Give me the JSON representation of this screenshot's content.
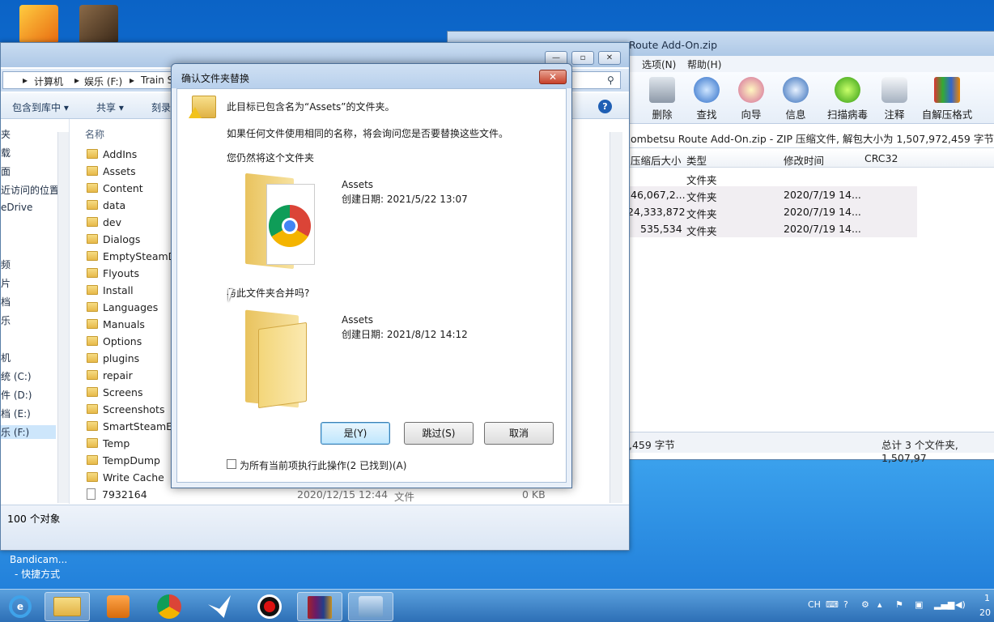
{
  "explorer": {
    "breadcrumb": [
      "计算机",
      "娱乐 (F:)",
      "Train S"
    ],
    "toolbar": {
      "include_library": "包含到库中",
      "share": "共享",
      "burn": "刻录"
    },
    "nav_items": [
      "夹",
      "载",
      "面",
      "近访问的位置",
      "eDrive",
      "",
      "",
      "频",
      "片",
      "档",
      "乐",
      "",
      "机",
      "统 (C:)",
      "件 (D:)",
      "档 (E:)",
      "乐 (F:)"
    ],
    "col_name": "名称",
    "files": [
      {
        "name": "AddIns",
        "type": "folder"
      },
      {
        "name": "Assets",
        "type": "folder"
      },
      {
        "name": "Content",
        "type": "folder"
      },
      {
        "name": "data",
        "type": "folder"
      },
      {
        "name": "dev",
        "type": "folder"
      },
      {
        "name": "Dialogs",
        "type": "folder"
      },
      {
        "name": "EmptySteamDe",
        "type": "folder"
      },
      {
        "name": "Flyouts",
        "type": "folder"
      },
      {
        "name": "Install",
        "type": "folder"
      },
      {
        "name": "Languages",
        "type": "folder"
      },
      {
        "name": "Manuals",
        "type": "folder"
      },
      {
        "name": "Options",
        "type": "folder"
      },
      {
        "name": "plugins",
        "type": "folder"
      },
      {
        "name": "repair",
        "type": "folder"
      },
      {
        "name": "Screens",
        "type": "folder"
      },
      {
        "name": "Screenshots",
        "type": "folder"
      },
      {
        "name": "SmartSteamEm",
        "type": "folder"
      },
      {
        "name": "Temp",
        "type": "folder"
      },
      {
        "name": "TempDump",
        "type": "folder"
      },
      {
        "name": "Write Cache",
        "type": "folder"
      },
      {
        "name": "7932164",
        "type": "file",
        "date": "2020/12/15 12:44",
        "kind": "文件",
        "size": "0 KB"
      }
    ],
    "status": "100 个对象"
  },
  "rar": {
    "title": "Route Add-On.zip",
    "menu": {
      "options": "选项(N)",
      "help": "帮助(H)"
    },
    "buttons": [
      "删除",
      "查找",
      "向导",
      "信息",
      "扫描病毒",
      "注释",
      "自解压格式"
    ],
    "info": "ombetsu Route Add-On.zip - ZIP 压缩文件, 解包大小为 1,507,972,459 字节",
    "headers": {
      "packed": "压缩后大小",
      "type": "类型",
      "modified": "修改时间",
      "crc": "CRC32"
    },
    "rows": [
      {
        "packed": "",
        "type": "文件夹",
        "modified": ""
      },
      {
        "packed": "46,067,2...",
        "type": "文件夹",
        "modified": "2020/7/19 14..."
      },
      {
        "packed": "24,333,872",
        "type": "文件夹",
        "modified": "2020/7/19 14..."
      },
      {
        "packed": "535,534",
        "type": "文件夹",
        "modified": "2020/7/19 14..."
      }
    ],
    "status_left": ",459 字节",
    "status_right": "总计 3 个文件夹, 1,507,97"
  },
  "dialog": {
    "title": "确认文件夹替换",
    "line1": "此目标已包含名为“Assets”的文件夹。",
    "line2": "如果任何文件使用相同的名称，将会询问您是否要替换这些文件。",
    "line3": "您仍然将这个文件夹",
    "src": {
      "name": "Assets",
      "date": "创建日期: 2021/5/22 13:07"
    },
    "merge_q": "与此文件夹合并吗?",
    "dst": {
      "name": "Assets",
      "date": "创建日期: 2021/8/12 14:12"
    },
    "btn_yes": "是(Y)",
    "btn_skip": "跳过(S)",
    "btn_cancel": "取消",
    "checkbox": "为所有当前项执行此操作(2 已找到)(A)"
  },
  "desktop": {
    "item1": "Bandicam...",
    "item2": "- 快捷方式"
  },
  "tray": {
    "lang": "CH",
    "clock_line1": "1",
    "clock_line2": "20"
  }
}
